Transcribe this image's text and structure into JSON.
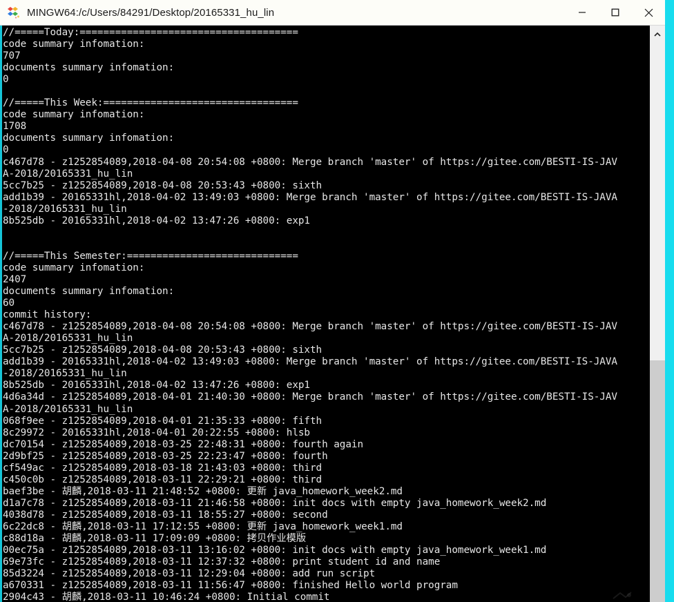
{
  "window": {
    "title": "MINGW64:/c/Users/84291/Desktop/20165331_hu_lin",
    "icon": "git-bash-icon",
    "controls": {
      "minimize": "—",
      "maximize": "☐",
      "close": "✕"
    }
  },
  "terminal": {
    "background_color": "#000000",
    "text_color": "#e6e6e6",
    "border_color": "#15c5d8",
    "lines": [
      "//=====Today:=====================================",
      "code summary infomation:",
      "707",
      "documents summary infomation:",
      "0",
      "",
      "//=====This Week:=================================",
      "code summary infomation:",
      "1708",
      "documents summary infomation:",
      "0",
      "c467d78 - z1252854089,2018-04-08 20:54:08 +0800: Merge branch 'master' of https://gitee.com/BESTI-IS-JAV",
      "A-2018/20165331_hu_lin",
      "5cc7b25 - z1252854089,2018-04-08 20:53:43 +0800: sixth",
      "add1b39 - 20165331hl,2018-04-02 13:49:03 +0800: Merge branch 'master' of https://gitee.com/BESTI-IS-JAVA",
      "-2018/20165331_hu_lin",
      "8b525db - 20165331hl,2018-04-02 13:47:26 +0800: exp1",
      "",
      "",
      "//=====This Semester:=============================",
      "code summary infomation:",
      "2407",
      "documents summary infomation:",
      "60",
      "commit history:",
      "c467d78 - z1252854089,2018-04-08 20:54:08 +0800: Merge branch 'master' of https://gitee.com/BESTI-IS-JAV",
      "A-2018/20165331_hu_lin",
      "5cc7b25 - z1252854089,2018-04-08 20:53:43 +0800: sixth",
      "add1b39 - 20165331hl,2018-04-02 13:49:03 +0800: Merge branch 'master' of https://gitee.com/BESTI-IS-JAVA",
      "-2018/20165331_hu_lin",
      "8b525db - 20165331hl,2018-04-02 13:47:26 +0800: exp1",
      "4d6a34d - z1252854089,2018-04-01 21:40:30 +0800: Merge branch 'master' of https://gitee.com/BESTI-IS-JAV",
      "A-2018/20165331_hu_lin",
      "068f9ee - z1252854089,2018-04-01 21:35:33 +0800: fifth",
      "8c29972 - 20165331hl,2018-04-01 20:22:55 +0800: hlsb",
      "dc70154 - z1252854089,2018-03-25 22:48:31 +0800: fourth again",
      "2d9bf25 - z1252854089,2018-03-25 22:23:47 +0800: fourth",
      "cf549ac - z1252854089,2018-03-18 21:43:03 +0800: third",
      "c450c0b - z1252854089,2018-03-11 22:29:21 +0800: third",
      "baef3be - 胡麟,2018-03-11 21:48:52 +0800: 更新 java_homework_week2.md",
      "d1a7c78 - z1252854089,2018-03-11 21:46:58 +0800: init docs with empty java_homework_week2.md",
      "4038d78 - z1252854089,2018-03-11 18:55:27 +0800: second",
      "6c22dc8 - 胡麟,2018-03-11 17:12:55 +0800: 更新 java_homework_week1.md",
      "c88d18a - 胡麟,2018-03-11 17:09:09 +0800: 拷贝作业模版",
      "00ec75a - z1252854089,2018-03-11 13:16:02 +0800: init docs with empty java_homework_week1.md",
      "69e73fc - z1252854089,2018-03-11 12:37:32 +0800: print student id and name",
      "85d3224 - z1252854089,2018-03-11 12:29:04 +0800: add run script",
      "a670331 - z1252854089,2018-03-11 11:56:47 +0800: finished Hello world program",
      "2904c43 - 胡麟,2018-03-11 10:46:24 +0800: Initial commit"
    ]
  },
  "scrollbar": {
    "up_arrow": "chevron-up-icon",
    "thumb_position": "bottom"
  }
}
